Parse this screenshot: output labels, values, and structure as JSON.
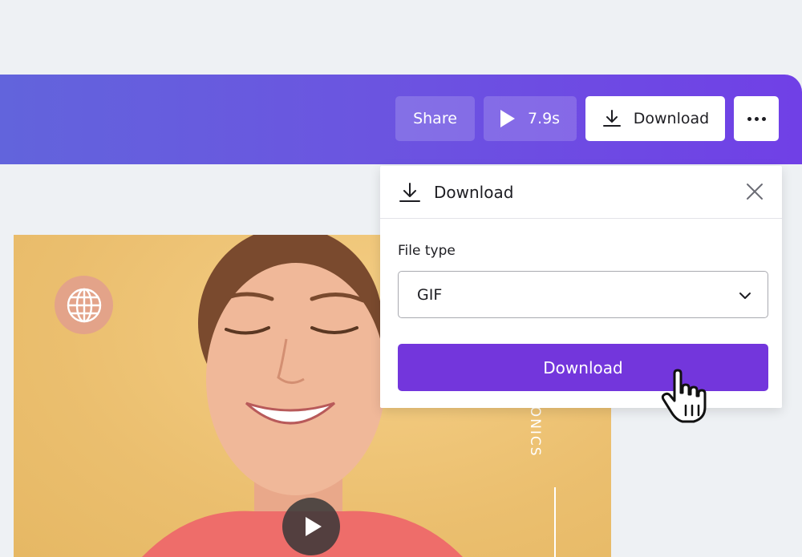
{
  "toolbar": {
    "share_label": "Share",
    "duration": "7.9s",
    "download_label": "Download",
    "more_icon": "more-horizontal-icon"
  },
  "download_panel": {
    "title": "Download",
    "file_type_label": "File type",
    "file_type_value": "GIF",
    "download_button_label": "Download"
  },
  "design": {
    "vertical_text": "RONICS"
  },
  "colors": {
    "toolbar_start": "#6264dc",
    "toolbar_end": "#7040e6",
    "primary_button": "#7336dc",
    "design_background": "#eec271",
    "globe_badge": "#e3a389"
  }
}
